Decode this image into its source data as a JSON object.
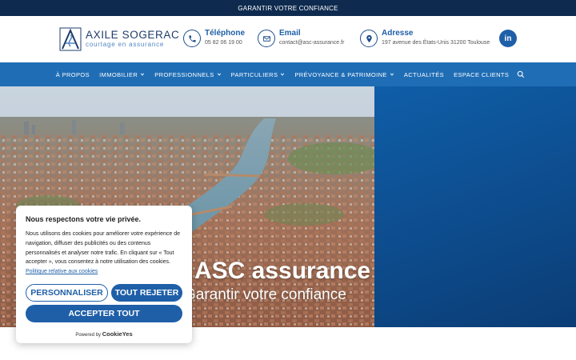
{
  "top_banner": {
    "text": "GARANTIR VOTRE CONFIANCE"
  },
  "header": {
    "logo": {
      "name": "AXILE SOGERAC",
      "tagline": "courtage en assurance"
    },
    "contacts": [
      {
        "icon": "phone-icon",
        "title": "Téléphone",
        "value": "05 82 06 19 00"
      },
      {
        "icon": "mail-icon",
        "title": "Email",
        "value": "contact@asc-assurance.fr"
      },
      {
        "icon": "location-icon",
        "title": "Adresse",
        "value": "197 avenue des États-Unis 31200 Toulouse"
      }
    ],
    "social": {
      "icon": "linkedin-icon",
      "label": "in"
    }
  },
  "nav": {
    "items": [
      {
        "label": "À PROPOS",
        "dropdown": false
      },
      {
        "label": "IMMOBILIER",
        "dropdown": true
      },
      {
        "label": "PROFESSIONNELS",
        "dropdown": true
      },
      {
        "label": "PARTICULIERS",
        "dropdown": true
      },
      {
        "label": "PRÉVOYANCE & PATRIMOINE",
        "dropdown": true
      },
      {
        "label": "ACTUALITÉS",
        "dropdown": false
      },
      {
        "label": "ESPACE CLIENTS",
        "dropdown": false
      }
    ],
    "search_icon": "search-icon"
  },
  "hero": {
    "title": "ASC assurance",
    "subtitle": "Garantir votre confiance"
  },
  "cookie": {
    "title": "Nous respectons votre vie privée.",
    "text": "Nous utilisons des cookies pour améliorer votre expérience de navigation, diffuser des publicités ou des contenus personnalisés et analyser notre trafic. En cliquant sur « Tout accepter », vous consentez à notre utilisation des cookies.",
    "link": "Politique relative aux cookies",
    "customize_label": "PERSONNALISER",
    "reject_label": "TOUT REJETER",
    "accept_label": "ACCEPTER TOUT",
    "powered_prefix": "Powered by",
    "powered_brand": "CookieYes"
  },
  "colors": {
    "banner": "#0e2a4e",
    "nav": "#1f6db5",
    "accent": "#1f5fa8"
  }
}
